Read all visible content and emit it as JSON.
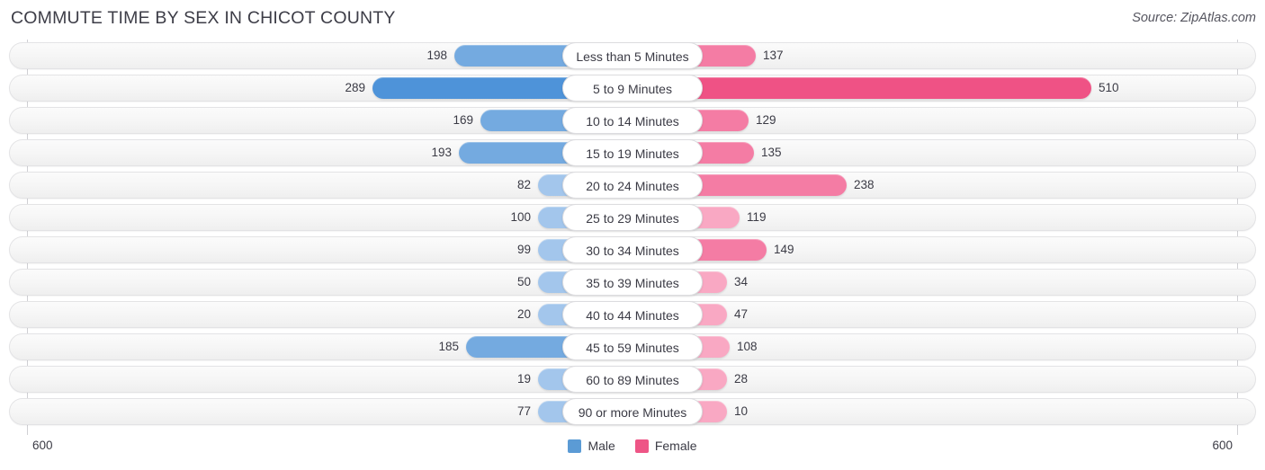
{
  "header": {
    "title": "COMMUTE TIME BY SEX IN CHICOT COUNTY",
    "source": "Source: ZipAtlas.com"
  },
  "axis": {
    "left_label": "600",
    "right_label": "600",
    "max": 600
  },
  "legend": {
    "items": [
      {
        "label": "Male",
        "color": "#5b9bd5"
      },
      {
        "label": "Female",
        "color": "#ee5586"
      }
    ]
  },
  "colors": {
    "male_strong": "#4e93d9",
    "male_mid": "#74aae0",
    "male_light": "#a3c6ec",
    "female_strong": "#ef5285",
    "female_mid": "#f47ca4",
    "female_light": "#f9a8c3",
    "track": "#f6f6f6",
    "axis": "#d0d0d4"
  },
  "chart_data": {
    "type": "bar",
    "orientation": "horizontal-diverging",
    "title": "COMMUTE TIME BY SEX IN CHICOT COUNTY",
    "xlabel": "",
    "ylabel": "",
    "xlim": [
      600,
      600
    ],
    "grid": false,
    "legend_position": "bottom-center",
    "categories": [
      "Less than 5 Minutes",
      "5 to 9 Minutes",
      "10 to 14 Minutes",
      "15 to 19 Minutes",
      "20 to 24 Minutes",
      "25 to 29 Minutes",
      "30 to 34 Minutes",
      "35 to 39 Minutes",
      "40 to 44 Minutes",
      "45 to 59 Minutes",
      "60 to 89 Minutes",
      "90 or more Minutes"
    ],
    "series": [
      {
        "name": "Male",
        "color": "#5b9bd5",
        "values": [
          198,
          289,
          169,
          193,
          82,
          100,
          99,
          50,
          20,
          185,
          19,
          77
        ]
      },
      {
        "name": "Female",
        "color": "#ee5586",
        "values": [
          137,
          510,
          129,
          135,
          238,
          119,
          149,
          34,
          47,
          108,
          28,
          10
        ]
      }
    ]
  }
}
